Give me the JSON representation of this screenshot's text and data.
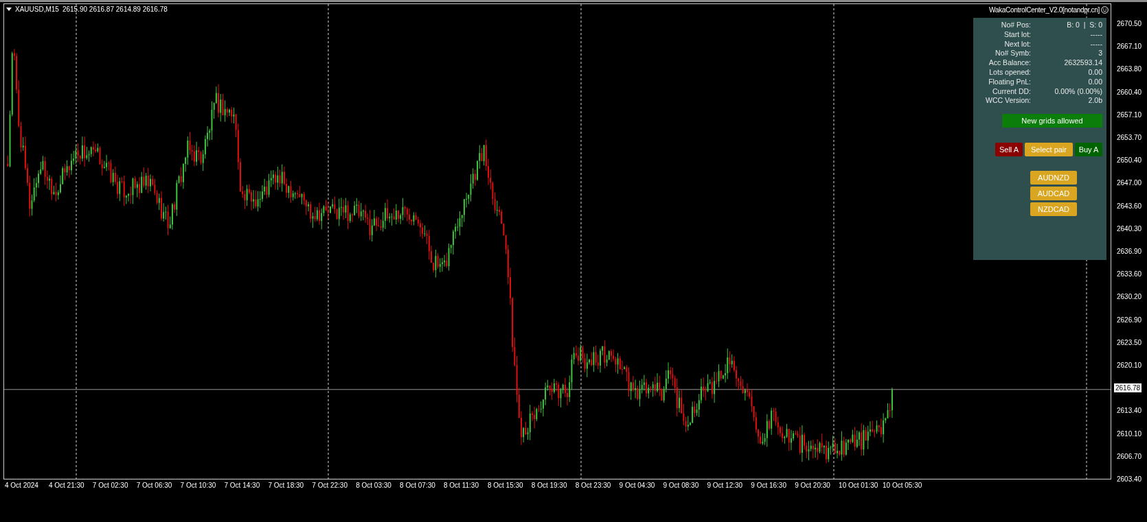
{
  "chart_header": {
    "symbol": "XAUUSD,M15",
    "ohlc": "2615.90 2616.87 2614.89 2616.78"
  },
  "panel": {
    "title": "WakaControlCenter_V2.0[notandpr.cn]",
    "stats": [
      {
        "label": "No# Pos:",
        "value": "B: 0  |  S: 0"
      },
      {
        "label": "Start lot:",
        "value": "-----"
      },
      {
        "label": "Next lot:",
        "value": "-----"
      },
      {
        "label": "No# Symb:",
        "value": "3"
      },
      {
        "label": "Acc Balance:",
        "value": "2632593.14"
      },
      {
        "label": "Lots opened:",
        "value": "0.00"
      },
      {
        "label": "Floating PnL:",
        "value": "0.00"
      },
      {
        "label": "Current DD:",
        "value": "0.00% (0.00%)"
      },
      {
        "label": "WCC Version:",
        "value": "2.0b"
      }
    ],
    "status": "New grids allowed",
    "buttons": [
      {
        "label": "Sell A",
        "kind": "sell"
      },
      {
        "label": "Select pair",
        "kind": "select"
      },
      {
        "label": "Buy A",
        "kind": "buy"
      }
    ],
    "pairs": [
      "AUDNZD",
      "AUDCAD",
      "NZDCAD"
    ]
  },
  "price_axis": {
    "labels": [
      "2670.50",
      "2667.10",
      "2663.80",
      "2660.40",
      "2657.10",
      "2653.70",
      "2650.40",
      "2647.00",
      "2643.60",
      "2640.30",
      "2636.90",
      "2633.60",
      "2630.20",
      "2626.90",
      "2623.50",
      "2620.10",
      "2613.40",
      "2610.10",
      "2606.70",
      "2603.40"
    ],
    "current_price": "2616.78"
  },
  "time_axis": {
    "labels": [
      "4 Oct 2024",
      "4 Oct 21:30",
      "7 Oct 02:30",
      "7 Oct 06:30",
      "7 Oct 10:30",
      "7 Oct 14:30",
      "7 Oct 18:30",
      "7 Oct 22:30",
      "8 Oct 03:30",
      "8 Oct 07:30",
      "8 Oct 11:30",
      "8 Oct 15:30",
      "8 Oct 19:30",
      "8 Oct 23:30",
      "9 Oct 04:30",
      "9 Oct 08:30",
      "9 Oct 12:30",
      "9 Oct 16:30",
      "9 Oct 20:30",
      "10 Oct 01:30",
      "10 Oct 05:30"
    ]
  }
}
